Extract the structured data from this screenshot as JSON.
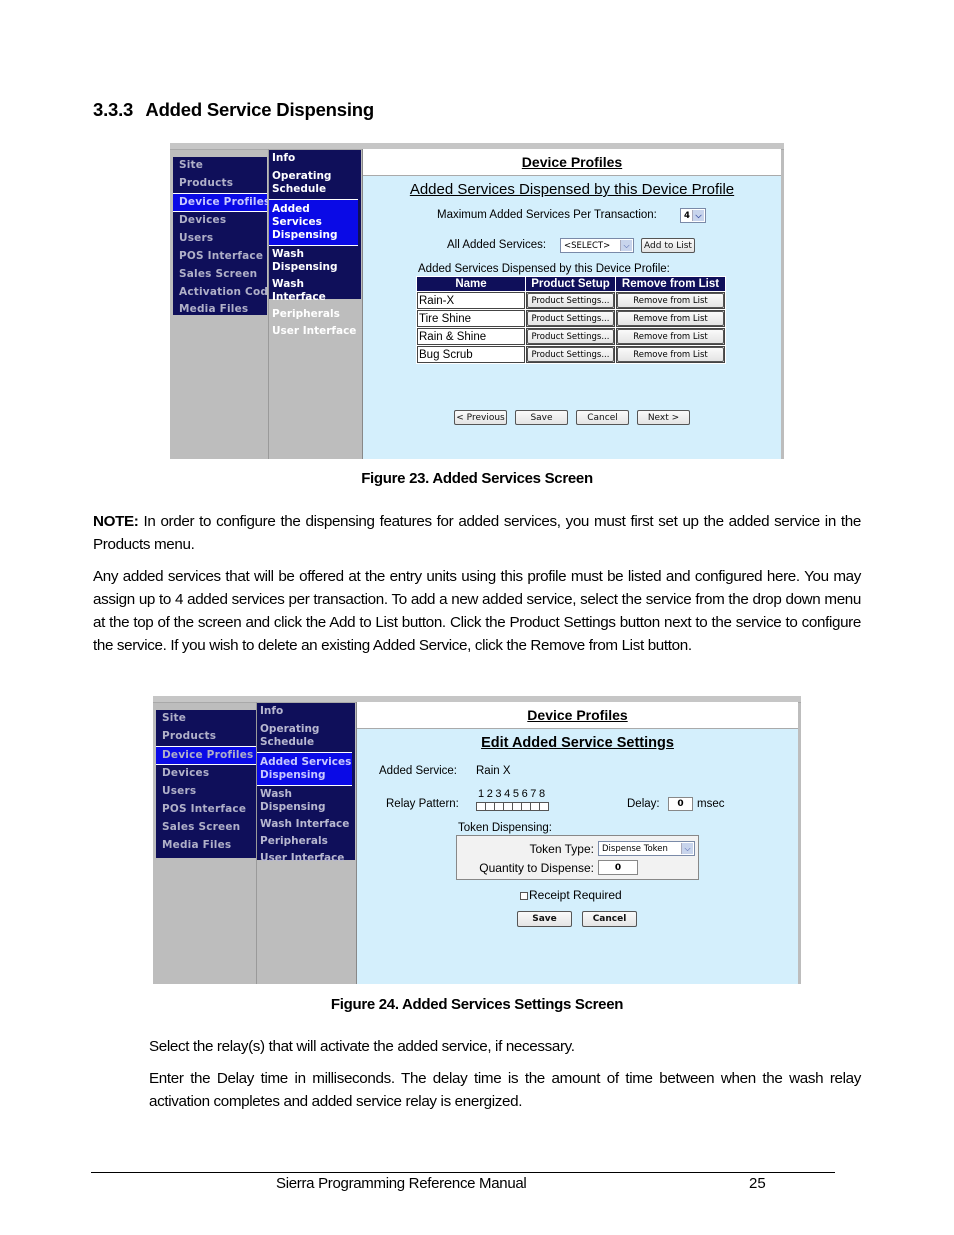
{
  "section": {
    "number": "3.3.3",
    "title": "Added Service Dispensing"
  },
  "figure1": {
    "caption": "Figure 23. Added Services Screen",
    "nav_primary": [
      "Site",
      "Products",
      "Device Profiles",
      "Devices",
      "Users",
      "POS Interface",
      "Sales Screen",
      "Activation Codes",
      "Media Files"
    ],
    "nav_primary_active": "Device Profiles",
    "nav_secondary": [
      "Info",
      "Operating Schedule",
      "Added Services Dispensing",
      "Wash Dispensing",
      "Wash Interface",
      "Peripherals",
      "User Interface"
    ],
    "nav_secondary_active": "Added Services Dispensing",
    "page_title": "Device Profiles",
    "subtitle": "Added Services Dispensed by this Device Profile",
    "max_label": "Maximum Added Services Per Transaction:",
    "max_value": "4",
    "all_label": "All Added Services:",
    "all_value": "<SELECT>",
    "add_button": "Add to List",
    "list_label": "Added Services Dispensed by this Device Profile:",
    "table": {
      "headers": [
        "Name",
        "Product Setup",
        "Remove from List"
      ],
      "rows": [
        {
          "name": "Rain-X",
          "setup": "Product Settings...",
          "remove": "Remove from List"
        },
        {
          "name": "Tire Shine",
          "setup": "Product Settings...",
          "remove": "Remove from List"
        },
        {
          "name": "Rain & Shine",
          "setup": "Product Settings...",
          "remove": "Remove from List"
        },
        {
          "name": "Bug Scrub",
          "setup": "Product Settings...",
          "remove": "Remove from List"
        }
      ]
    },
    "buttons": {
      "previous": "< Previous",
      "save": "Save",
      "cancel": "Cancel",
      "next": "Next >"
    }
  },
  "note": {
    "label": "NOTE:",
    "text": " In order to configure the dispensing features for added services, you must first set up the added service in the Products menu."
  },
  "paragraph1": "Any added services that will be offered at the entry units using this profile must be listed and configured here. You may assign up to 4 added services per transaction. To add a new added service, select the service from the drop down menu at the top of the screen and click the Add to List button. Click the Product Settings button next to the service to configure the service. If you wish to delete an existing Added Service, click the Remove from List button.",
  "figure2": {
    "caption": "Figure 24. Added Services Settings Screen",
    "nav_primary": [
      "Site",
      "Products",
      "Device Profiles",
      "Devices",
      "Users",
      "POS Interface",
      "Sales Screen",
      "Media Files"
    ],
    "nav_primary_active": "Device Profiles",
    "nav_secondary": [
      "Info",
      "Operating Schedule",
      "Added Services Dispensing",
      "Wash Dispensing",
      "Wash Interface",
      "Peripherals",
      "User Interface"
    ],
    "nav_secondary_active": "Added Services Dispensing",
    "page_title": "Device Profiles",
    "subtitle": "Edit Added Service Settings",
    "service_label": "Added Service:",
    "service_value": "Rain X",
    "relay_label": "Relay Pattern:",
    "relay_numbers": "12345678",
    "relay_count": 8,
    "delay_label": "Delay:",
    "delay_value": "0",
    "delay_unit": "msec",
    "token_section": "Token Dispensing:",
    "token_type_label": "Token Type:",
    "token_type_value": "Dispense Token",
    "quantity_label": "Quantity to Dispense:",
    "quantity_value": "0",
    "receipt_label": "Receipt Required",
    "receipt_checked": false,
    "buttons": {
      "save": "Save",
      "cancel": "Cancel"
    }
  },
  "paragraph2": "Select the relay(s) that will activate the added service, if necessary.",
  "paragraph3": "Enter the Delay time in milliseconds. The delay time is the amount of time between when the wash relay activation completes and added service relay is energized.",
  "footer": {
    "title": "Sierra Programming Reference Manual",
    "page": "25"
  }
}
